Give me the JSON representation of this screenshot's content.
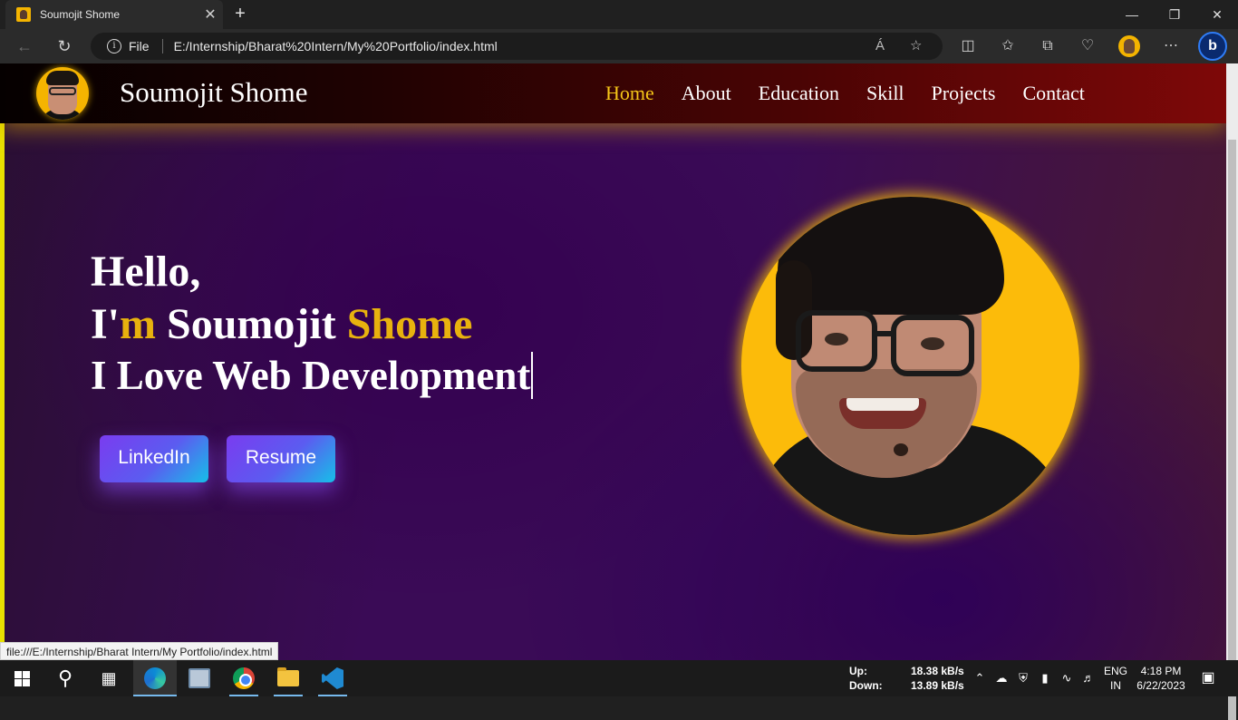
{
  "browser": {
    "tab_title": "Soumojit Shome",
    "tab_close": "✕",
    "new_tab": "+",
    "address_scheme_label": "File",
    "address_url": "E:/Internship/Bharat%20Intern/My%20Portfolio/index.html",
    "status_url": "file:///E:/Internship/Bharat Intern/My Portfolio/index.html",
    "read_aloud_icon": "Á",
    "icons": [
      "back-icon",
      "refresh-icon",
      "info-icon",
      "read-aloud-icon",
      "favorite-star-icon",
      "split-screen-icon",
      "favorites-icon",
      "collections-icon",
      "browser-essentials-icon",
      "profile-icon",
      "more-icon",
      "bing-icon"
    ]
  },
  "site": {
    "brand_name": "Soumojit Shome",
    "menu": [
      {
        "label": "Home",
        "active": true
      },
      {
        "label": "About",
        "active": false
      },
      {
        "label": "Education",
        "active": false
      },
      {
        "label": "Skill",
        "active": false
      },
      {
        "label": "Projects",
        "active": false
      },
      {
        "label": "Contact",
        "active": false
      }
    ],
    "hero": {
      "greeting": "Hello,",
      "intro_i": "I'",
      "intro_m": "m",
      "intro_first": " Soumojit ",
      "intro_last": "Shome",
      "tagline": "I Love Web Development"
    },
    "buttons": {
      "linkedin": "LinkedIn",
      "resume": "Resume"
    },
    "colors": {
      "accent_gold": "#e8b20e",
      "active_menu": "#f5c518",
      "header_red": "#7e0808",
      "bg_purple": "#3a0b56"
    }
  },
  "taskbar": {
    "net_up_label": "Up:",
    "net_down_label": "Down:",
    "net_up_value": "18.38 kB/s",
    "net_down_value": "13.89 kB/s",
    "lang_top": "ENG",
    "lang_bottom": "IN",
    "time": "4:18 PM",
    "date": "6/22/2023",
    "icons": [
      "start-icon",
      "search-icon",
      "task-view-icon",
      "edge-icon",
      "photos-icon",
      "chrome-icon",
      "file-explorer-icon",
      "vscode-icon",
      "chevron-up-icon",
      "onedrive-icon",
      "defender-icon",
      "battery-icon",
      "wifi-icon",
      "volume-icon",
      "notifications-icon"
    ]
  }
}
